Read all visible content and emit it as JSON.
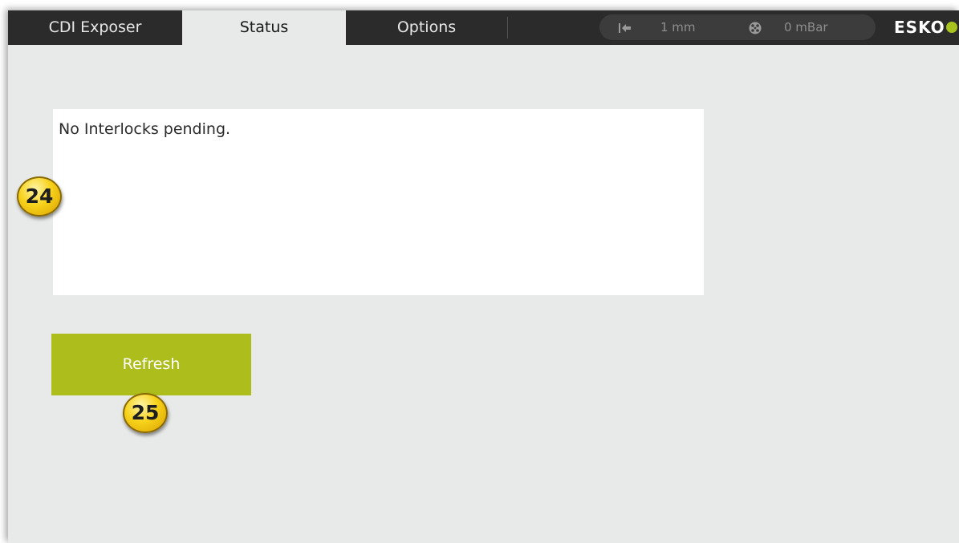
{
  "tabs": [
    {
      "label": "CDI Exposer",
      "active": false
    },
    {
      "label": "Status",
      "active": true
    },
    {
      "label": "Options",
      "active": false
    }
  ],
  "status_bar": {
    "position_icon": "arrow-to-start-icon",
    "position_value": "1 mm",
    "vacuum_icon": "vacuum-fan-icon",
    "vacuum_value": "0 mBar"
  },
  "brand": {
    "logo_text": "ESKO",
    "logo_icon": "esko-dot-icon",
    "accent_color": "#a8c21e"
  },
  "main": {
    "interlock_message": "No Interlocks pending.",
    "refresh_label": "Refresh",
    "button_color": "#adbd1c"
  },
  "callouts": [
    "24",
    "25"
  ]
}
